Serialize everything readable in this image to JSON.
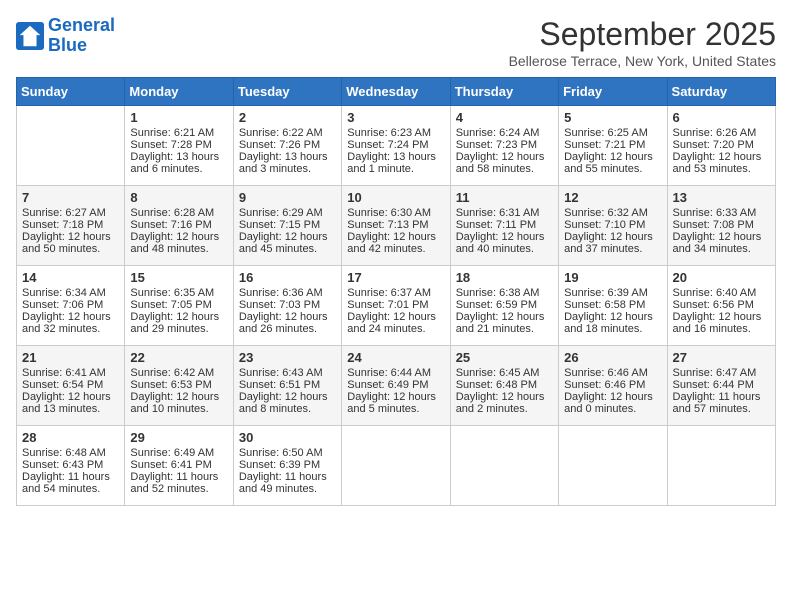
{
  "header": {
    "logo_line1": "General",
    "logo_line2": "Blue",
    "month": "September 2025",
    "location": "Bellerose Terrace, New York, United States"
  },
  "weekdays": [
    "Sunday",
    "Monday",
    "Tuesday",
    "Wednesday",
    "Thursday",
    "Friday",
    "Saturday"
  ],
  "weeks": [
    [
      {
        "num": "",
        "sunrise": "",
        "sunset": "",
        "daylight": ""
      },
      {
        "num": "1",
        "sunrise": "Sunrise: 6:21 AM",
        "sunset": "Sunset: 7:28 PM",
        "daylight": "Daylight: 13 hours and 6 minutes."
      },
      {
        "num": "2",
        "sunrise": "Sunrise: 6:22 AM",
        "sunset": "Sunset: 7:26 PM",
        "daylight": "Daylight: 13 hours and 3 minutes."
      },
      {
        "num": "3",
        "sunrise": "Sunrise: 6:23 AM",
        "sunset": "Sunset: 7:24 PM",
        "daylight": "Daylight: 13 hours and 1 minute."
      },
      {
        "num": "4",
        "sunrise": "Sunrise: 6:24 AM",
        "sunset": "Sunset: 7:23 PM",
        "daylight": "Daylight: 12 hours and 58 minutes."
      },
      {
        "num": "5",
        "sunrise": "Sunrise: 6:25 AM",
        "sunset": "Sunset: 7:21 PM",
        "daylight": "Daylight: 12 hours and 55 minutes."
      },
      {
        "num": "6",
        "sunrise": "Sunrise: 6:26 AM",
        "sunset": "Sunset: 7:20 PM",
        "daylight": "Daylight: 12 hours and 53 minutes."
      }
    ],
    [
      {
        "num": "7",
        "sunrise": "Sunrise: 6:27 AM",
        "sunset": "Sunset: 7:18 PM",
        "daylight": "Daylight: 12 hours and 50 minutes."
      },
      {
        "num": "8",
        "sunrise": "Sunrise: 6:28 AM",
        "sunset": "Sunset: 7:16 PM",
        "daylight": "Daylight: 12 hours and 48 minutes."
      },
      {
        "num": "9",
        "sunrise": "Sunrise: 6:29 AM",
        "sunset": "Sunset: 7:15 PM",
        "daylight": "Daylight: 12 hours and 45 minutes."
      },
      {
        "num": "10",
        "sunrise": "Sunrise: 6:30 AM",
        "sunset": "Sunset: 7:13 PM",
        "daylight": "Daylight: 12 hours and 42 minutes."
      },
      {
        "num": "11",
        "sunrise": "Sunrise: 6:31 AM",
        "sunset": "Sunset: 7:11 PM",
        "daylight": "Daylight: 12 hours and 40 minutes."
      },
      {
        "num": "12",
        "sunrise": "Sunrise: 6:32 AM",
        "sunset": "Sunset: 7:10 PM",
        "daylight": "Daylight: 12 hours and 37 minutes."
      },
      {
        "num": "13",
        "sunrise": "Sunrise: 6:33 AM",
        "sunset": "Sunset: 7:08 PM",
        "daylight": "Daylight: 12 hours and 34 minutes."
      }
    ],
    [
      {
        "num": "14",
        "sunrise": "Sunrise: 6:34 AM",
        "sunset": "Sunset: 7:06 PM",
        "daylight": "Daylight: 12 hours and 32 minutes."
      },
      {
        "num": "15",
        "sunrise": "Sunrise: 6:35 AM",
        "sunset": "Sunset: 7:05 PM",
        "daylight": "Daylight: 12 hours and 29 minutes."
      },
      {
        "num": "16",
        "sunrise": "Sunrise: 6:36 AM",
        "sunset": "Sunset: 7:03 PM",
        "daylight": "Daylight: 12 hours and 26 minutes."
      },
      {
        "num": "17",
        "sunrise": "Sunrise: 6:37 AM",
        "sunset": "Sunset: 7:01 PM",
        "daylight": "Daylight: 12 hours and 24 minutes."
      },
      {
        "num": "18",
        "sunrise": "Sunrise: 6:38 AM",
        "sunset": "Sunset: 6:59 PM",
        "daylight": "Daylight: 12 hours and 21 minutes."
      },
      {
        "num": "19",
        "sunrise": "Sunrise: 6:39 AM",
        "sunset": "Sunset: 6:58 PM",
        "daylight": "Daylight: 12 hours and 18 minutes."
      },
      {
        "num": "20",
        "sunrise": "Sunrise: 6:40 AM",
        "sunset": "Sunset: 6:56 PM",
        "daylight": "Daylight: 12 hours and 16 minutes."
      }
    ],
    [
      {
        "num": "21",
        "sunrise": "Sunrise: 6:41 AM",
        "sunset": "Sunset: 6:54 PM",
        "daylight": "Daylight: 12 hours and 13 minutes."
      },
      {
        "num": "22",
        "sunrise": "Sunrise: 6:42 AM",
        "sunset": "Sunset: 6:53 PM",
        "daylight": "Daylight: 12 hours and 10 minutes."
      },
      {
        "num": "23",
        "sunrise": "Sunrise: 6:43 AM",
        "sunset": "Sunset: 6:51 PM",
        "daylight": "Daylight: 12 hours and 8 minutes."
      },
      {
        "num": "24",
        "sunrise": "Sunrise: 6:44 AM",
        "sunset": "Sunset: 6:49 PM",
        "daylight": "Daylight: 12 hours and 5 minutes."
      },
      {
        "num": "25",
        "sunrise": "Sunrise: 6:45 AM",
        "sunset": "Sunset: 6:48 PM",
        "daylight": "Daylight: 12 hours and 2 minutes."
      },
      {
        "num": "26",
        "sunrise": "Sunrise: 6:46 AM",
        "sunset": "Sunset: 6:46 PM",
        "daylight": "Daylight: 12 hours and 0 minutes."
      },
      {
        "num": "27",
        "sunrise": "Sunrise: 6:47 AM",
        "sunset": "Sunset: 6:44 PM",
        "daylight": "Daylight: 11 hours and 57 minutes."
      }
    ],
    [
      {
        "num": "28",
        "sunrise": "Sunrise: 6:48 AM",
        "sunset": "Sunset: 6:43 PM",
        "daylight": "Daylight: 11 hours and 54 minutes."
      },
      {
        "num": "29",
        "sunrise": "Sunrise: 6:49 AM",
        "sunset": "Sunset: 6:41 PM",
        "daylight": "Daylight: 11 hours and 52 minutes."
      },
      {
        "num": "30",
        "sunrise": "Sunrise: 6:50 AM",
        "sunset": "Sunset: 6:39 PM",
        "daylight": "Daylight: 11 hours and 49 minutes."
      },
      {
        "num": "",
        "sunrise": "",
        "sunset": "",
        "daylight": ""
      },
      {
        "num": "",
        "sunrise": "",
        "sunset": "",
        "daylight": ""
      },
      {
        "num": "",
        "sunrise": "",
        "sunset": "",
        "daylight": ""
      },
      {
        "num": "",
        "sunrise": "",
        "sunset": "",
        "daylight": ""
      }
    ]
  ]
}
